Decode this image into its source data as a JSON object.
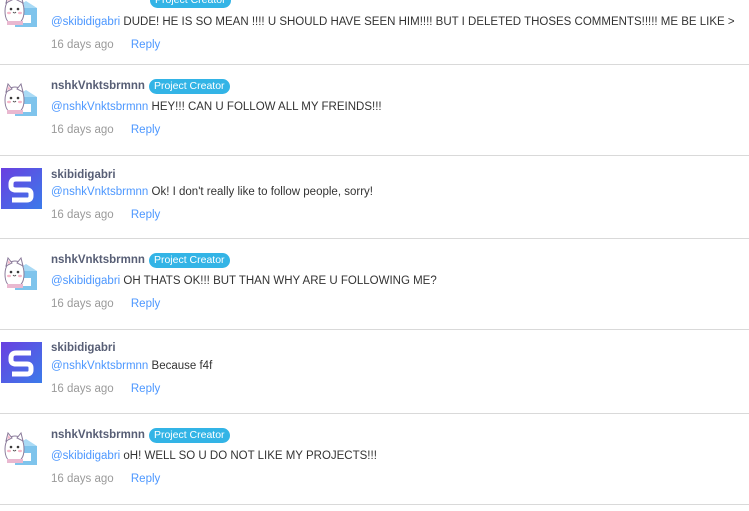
{
  "comments": [
    {
      "avatar": "cat-milk-carton-avatar",
      "username": "",
      "badge": "",
      "mention": "@skibidigabri",
      "text": "DUDE! HE IS SO MEAN !!!! U SHOULD HAVE SEEN HIM!!!! BUT I DELETED THOSES COMMENTS!!!!! ME BE LIKE >",
      "time": "16 days ago",
      "reply": "Reply"
    },
    {
      "avatar": "cat-milk-carton-avatar",
      "username": "nshkVnktsbrmnn",
      "badge": "Project Creator",
      "mention": "@nshkVnktsbrmnn",
      "text": "HEY!!! CAN U FOLLOW ALL MY FREINDS!!!",
      "time": "16 days ago",
      "reply": "Reply"
    },
    {
      "avatar": "letter-s-avatar",
      "username": "skibidigabri",
      "badge": "",
      "mention": "@nshkVnktsbrmnn",
      "text": "Ok! I don't really like to follow people, sorry!",
      "time": "16 days ago",
      "reply": "Reply"
    },
    {
      "avatar": "cat-milk-carton-avatar",
      "username": "nshkVnktsbrmnn",
      "badge": "Project Creator",
      "mention": "@skibidigabri",
      "text": "OH THATS OK!!! BUT THAN WHY ARE U FOLLOWING ME?",
      "time": "16 days ago",
      "reply": "Reply"
    },
    {
      "avatar": "letter-s-avatar",
      "username": "skibidigabri",
      "badge": "",
      "mention": "@nshkVnktsbrmnn",
      "text": "Because f4f",
      "time": "16 days ago",
      "reply": "Reply"
    },
    {
      "avatar": "cat-milk-carton-avatar",
      "username": "nshkVnktsbrmnn",
      "badge": "Project Creator",
      "mention": "@skibidigabri",
      "text": "oH! WELL SO U DO NOT LIKE MY PROJECTS!!!",
      "time": "16 days ago",
      "reply": "Reply"
    }
  ],
  "colors": {
    "mention": "#4c97ff",
    "badge": "#33b4e6",
    "username": "#575e75",
    "timestamp": "#9a9a9a",
    "divider": "#d9d9d9",
    "s_avatar_bg": "#5d4ee8"
  }
}
